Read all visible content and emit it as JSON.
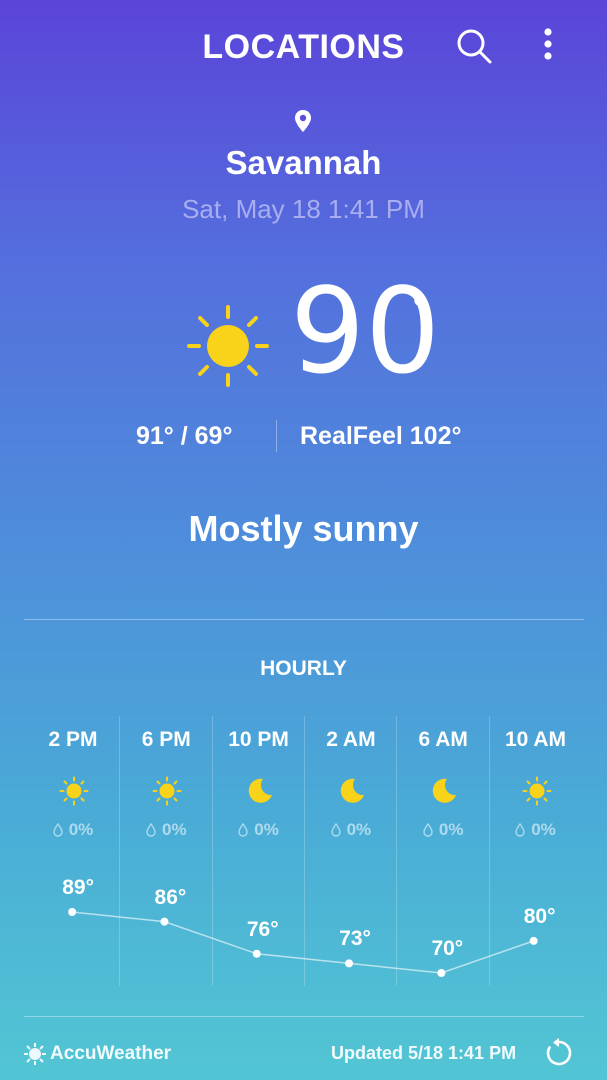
{
  "header": {
    "title": "LOCATIONS",
    "search_icon": "search-icon",
    "menu_icon": "more-vert-icon"
  },
  "location": {
    "icon": "location-pin-icon",
    "city": "Savannah",
    "datetime": "Sat, May 18 1:41 PM"
  },
  "current": {
    "icon": "sun-icon",
    "temp": "90",
    "degree": "°",
    "high_low": "91°  /  69°",
    "realfeel": "RealFeel 102°",
    "condition": "Mostly sunny"
  },
  "hourly": {
    "label": "HOURLY",
    "items": [
      {
        "time": "2 PM",
        "icon": "sun-icon",
        "precip": "0%",
        "temp": "89°",
        "value": 89
      },
      {
        "time": "6 PM",
        "icon": "sun-icon",
        "precip": "0%",
        "temp": "86°",
        "value": 86
      },
      {
        "time": "10 PM",
        "icon": "moon-icon",
        "precip": "0%",
        "temp": "76°",
        "value": 76
      },
      {
        "time": "2 AM",
        "icon": "moon-icon",
        "precip": "0%",
        "temp": "73°",
        "value": 73
      },
      {
        "time": "6 AM",
        "icon": "moon-icon",
        "precip": "0%",
        "temp": "70°",
        "value": 70
      },
      {
        "time": "10 AM",
        "icon": "sun-icon",
        "precip": "0%",
        "temp": "80°",
        "value": 80
      }
    ]
  },
  "footer": {
    "brand": "AccuWeather",
    "updated": "Updated  5/18  1:41 PM",
    "refresh_icon": "refresh-icon"
  },
  "colors": {
    "sun": "#f9d21a",
    "date_text": "#a9aef0",
    "gradient_top": "#5a44d9",
    "gradient_bottom": "#52c6d4"
  }
}
